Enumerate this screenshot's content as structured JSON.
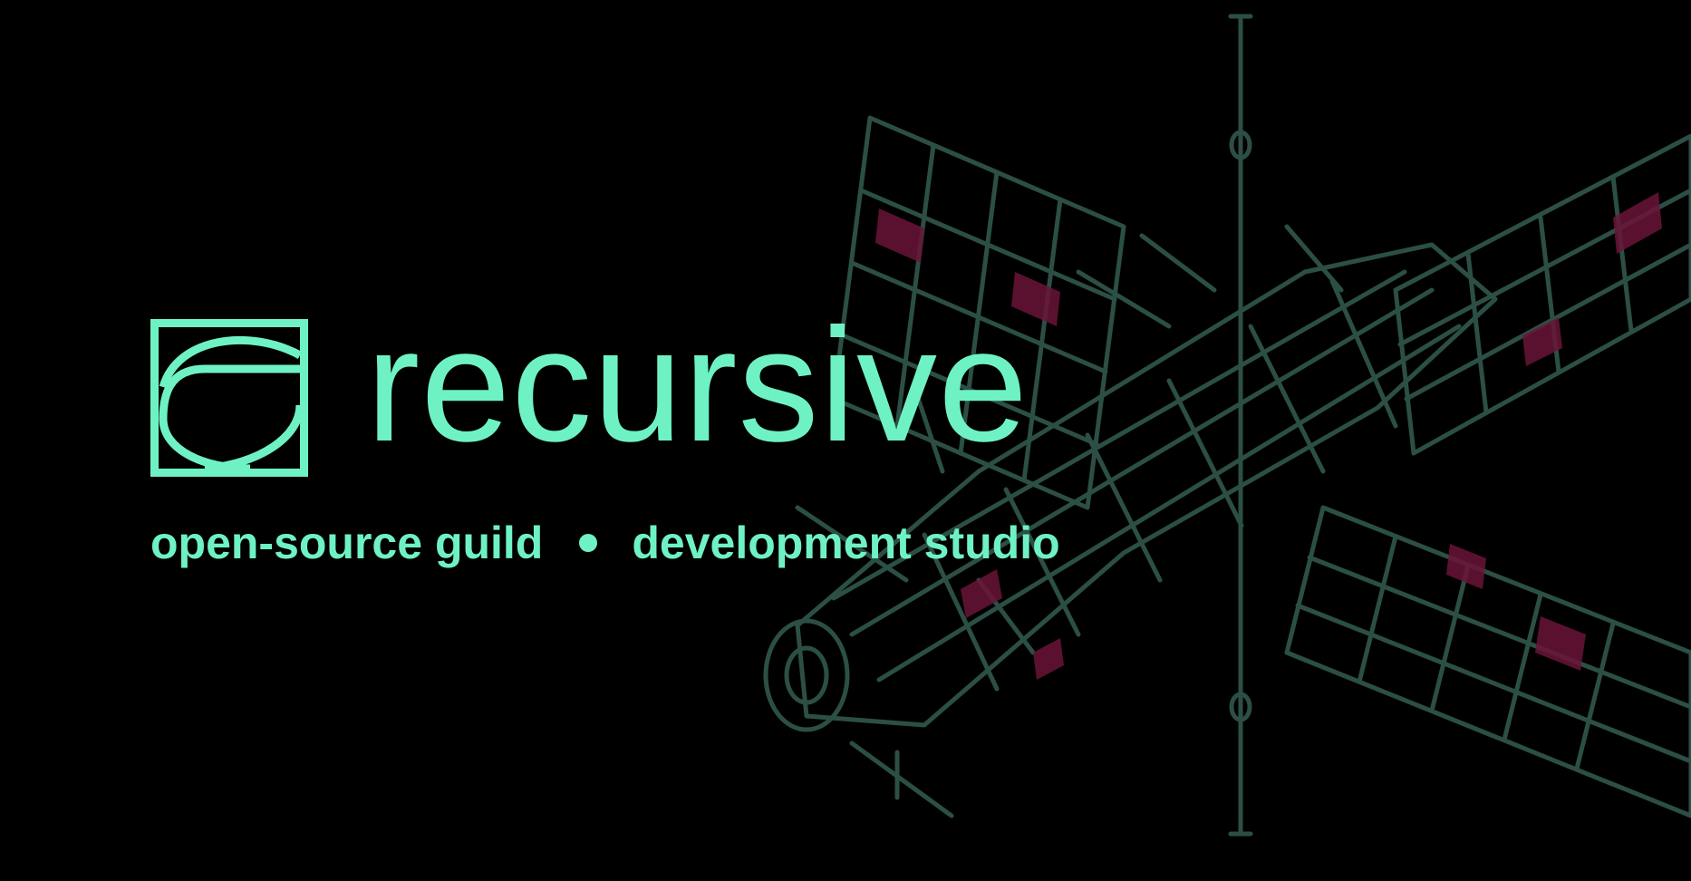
{
  "colors": {
    "background": "#000000",
    "accent": "#6ff2c3",
    "station_line": "#2c4f45",
    "station_panel": "#6a1438"
  },
  "brand": {
    "logo_icon": "recursive-logo-icon",
    "name": "recursive"
  },
  "tagline": {
    "left": "open-source guild",
    "separator_icon": "bullet-dot-icon",
    "right": "development studio"
  },
  "illustration": {
    "icon": "space-station-illustration"
  }
}
